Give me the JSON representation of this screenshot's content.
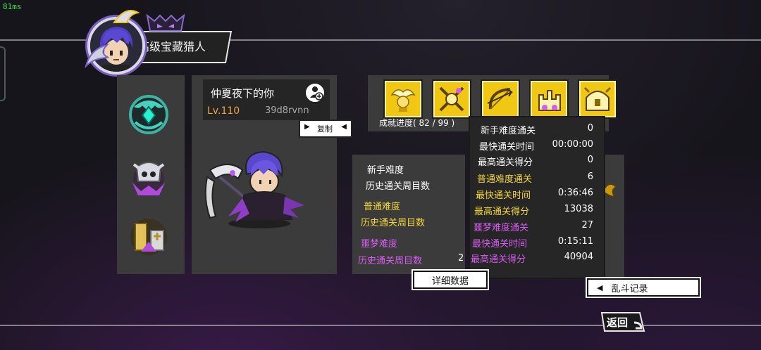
{
  "status": {
    "ping": "81ms"
  },
  "header": {
    "title": "高级宝藏猎人"
  },
  "player": {
    "name": "仲夏夜下的你",
    "level": "Lv.110",
    "uid": "39d8rvnn",
    "copy_label": "复制"
  },
  "achievements": {
    "progress_label": "成就进度( 82 / 99 )"
  },
  "left_stats": {
    "novice_title": "新手难度",
    "novice_runs_label": "历史通关周目数",
    "normal_title": "普通难度",
    "normal_runs_label": "历史通关周目数",
    "nightmare_title": "噩梦难度",
    "nightmare_runs_label": "历史通关周目数",
    "nightmare_runs_partial": "2"
  },
  "detail_popup": {
    "rows": [
      {
        "label": "新手难度通关",
        "value": "0",
        "color": "white"
      },
      {
        "label": "最快通关时间",
        "value": "00:00:00",
        "color": "white"
      },
      {
        "label": "最高通关得分",
        "value": "0",
        "color": "white"
      },
      {
        "label": "普通难度通关",
        "value": "6",
        "color": "yellow"
      },
      {
        "label": "最快通关时间",
        "value": "0:36:46",
        "color": "yellow"
      },
      {
        "label": "最高通关得分",
        "value": "13038",
        "color": "yellow"
      },
      {
        "label": "噩梦难度通关",
        "value": "27",
        "color": "purple"
      },
      {
        "label": "最快通关时间",
        "value": "0:15:11",
        "color": "purple"
      },
      {
        "label": "最高通关得分",
        "value": "40904",
        "color": "purple"
      }
    ]
  },
  "buttons": {
    "detail": "详细数据",
    "brawl": "乱斗记录",
    "back": "返回"
  },
  "colors": {
    "yellow": "#f3d53a",
    "purple": "#d65cf0",
    "level": "#f0a23a"
  }
}
